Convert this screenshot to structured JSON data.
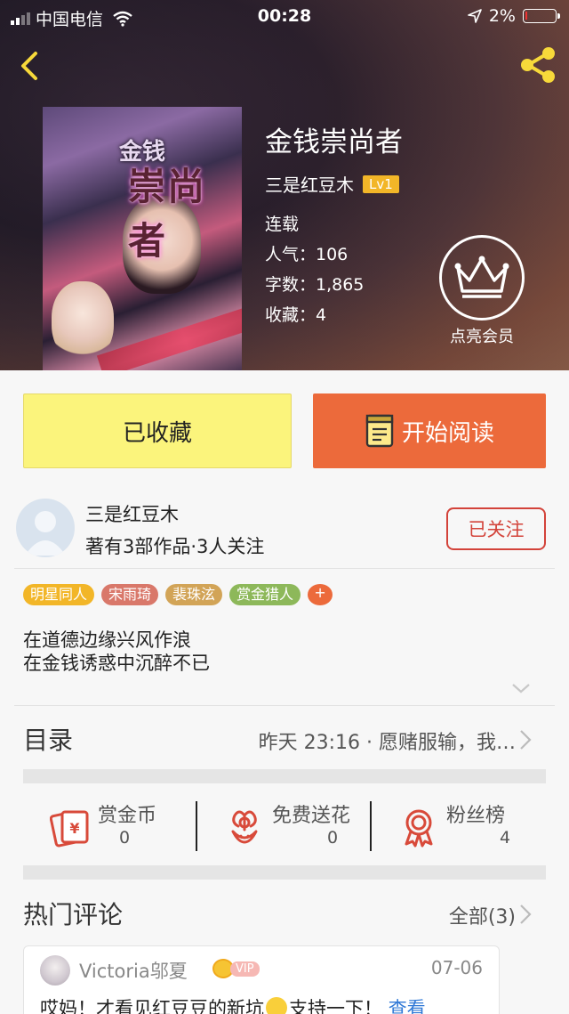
{
  "status_bar": {
    "carrier": "中国电信",
    "time": "00:28",
    "battery_percent": "2%",
    "battery_level": 0.02
  },
  "book": {
    "cover_title_small": "金钱",
    "cover_title_large": "崇尚者",
    "title": "金钱崇尚者",
    "author": "三是红豆木",
    "level": "Lv1",
    "status": "连载",
    "popularity": "人气：106",
    "word_count": "字数：1,865",
    "favorites": "收藏：4"
  },
  "vip": {
    "label": "点亮会员"
  },
  "actions": {
    "favorite_label": "已收藏",
    "read_label": "开始阅读"
  },
  "author_card": {
    "name": "三是红豆木",
    "stats": "著有3部作品·3人关注",
    "follow_label": "已关注"
  },
  "tags": [
    {
      "label": "明星同人",
      "color": "#f2b628"
    },
    {
      "label": "宋雨琦",
      "color": "#d9786a"
    },
    {
      "label": "裴珠泫",
      "color": "#d2a457"
    },
    {
      "label": "赏金猎人",
      "color": "#8db85a"
    },
    {
      "label": "+",
      "color": "#ec6a3b"
    }
  ],
  "description": {
    "line1": "在道德边缘兴风作浪",
    "line2": "在金钱诱惑中沉醉不已"
  },
  "toc": {
    "label": "目录",
    "latest": "昨天 23:16 · 愿赌服输，我…"
  },
  "rewards": [
    {
      "title": "赏金币",
      "value": "0",
      "icon": "coin-envelope-icon"
    },
    {
      "title": "免费送花",
      "value": "0",
      "icon": "flower-icon"
    },
    {
      "title": "粉丝榜",
      "value": "4",
      "icon": "medal-icon"
    }
  ],
  "hot_comments": {
    "label": "热门评论",
    "all_label": "全部(3)",
    "items": [
      {
        "user": "Victoria邬夏",
        "vip_label": "VIP",
        "date": "07-06",
        "text": "哎妈！才看见红豆豆的新坑",
        "text_after_emoji": "支持一下！",
        "more_label": "查看"
      }
    ]
  },
  "colors": {
    "accent_orange": "#ec6a3b",
    "fav_yellow": "#fbf47c",
    "follow_red": "#d3433a",
    "level_gold": "#f2b628"
  }
}
